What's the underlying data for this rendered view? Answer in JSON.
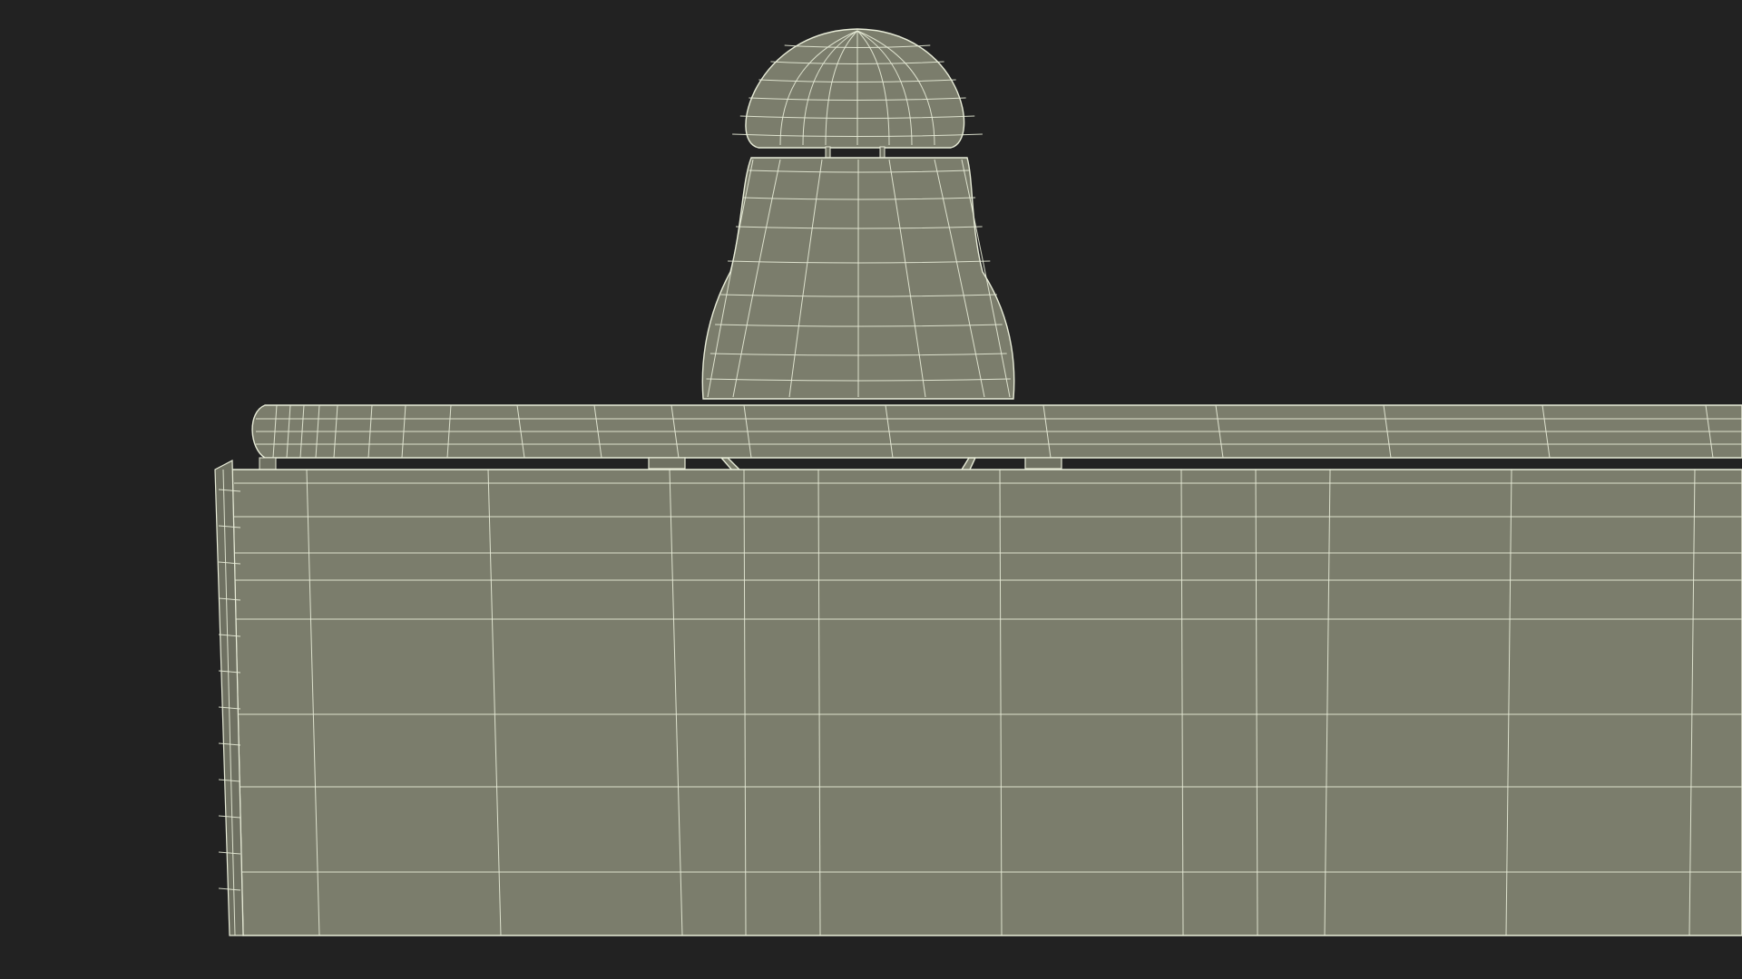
{
  "scene": {
    "background_color": "#222222",
    "surface_color": "#7b7d6c",
    "surface_shade_color": "#6f7162",
    "wire_color": "#e8ecd8",
    "objects": [
      "reception-desk-wireframe",
      "office-chair-wireframe"
    ]
  }
}
